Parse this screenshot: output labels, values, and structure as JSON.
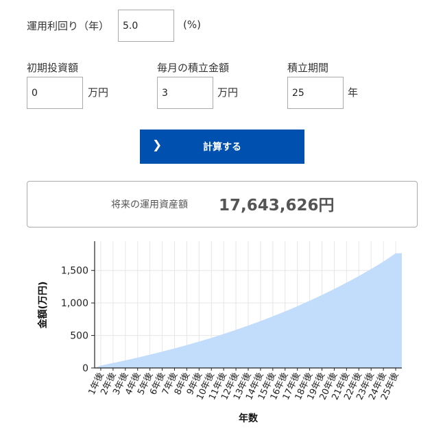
{
  "yield_section": {
    "label": "運用利回り（年）",
    "value": "5.0",
    "unit": "(%)"
  },
  "initial_section": {
    "label": "初期投資額",
    "value": "0",
    "unit": "万円"
  },
  "monthly_section": {
    "label": "毎月の積立金額",
    "value": "3",
    "unit": "万円"
  },
  "period_section": {
    "label": "積立期間",
    "value": "25",
    "unit": "年"
  },
  "calc_button": {
    "icon": "chevron-right-icon",
    "label": "計算する",
    "color": "#0050b0"
  },
  "result": {
    "label": "将来の運用資産額",
    "value": "17,643,626円"
  },
  "chart_data": {
    "type": "area",
    "xlabel": "年数",
    "ylabel": "金額(万円)",
    "ylim": [
      0,
      1950
    ],
    "yticks": [
      0,
      500,
      1000,
      1500
    ],
    "ytick_labels": [
      "0",
      "500",
      "1,000",
      "1,500"
    ],
    "grid": true,
    "legend": "none",
    "fill_color": "#c2dcfc",
    "categories": [
      "1年後",
      "2年後",
      "3年後",
      "4年後",
      "5年後",
      "6年後",
      "7年後",
      "8年後",
      "9年後",
      "10年後",
      "11年後",
      "12年後",
      "13年後",
      "14年後",
      "15年後",
      "16年後",
      "17年後",
      "18年後",
      "19年後",
      "20年後",
      "21年後",
      "22年後",
      "23年後",
      "24年後",
      "25年後"
    ],
    "values": [
      37,
      76,
      116,
      159,
      204,
      251,
      300,
      352,
      406,
      463,
      523,
      586,
      652,
      721,
      794,
      870,
      950,
      1034,
      1122,
      1215,
      1312,
      1414,
      1522,
      1635,
      1764
    ]
  }
}
